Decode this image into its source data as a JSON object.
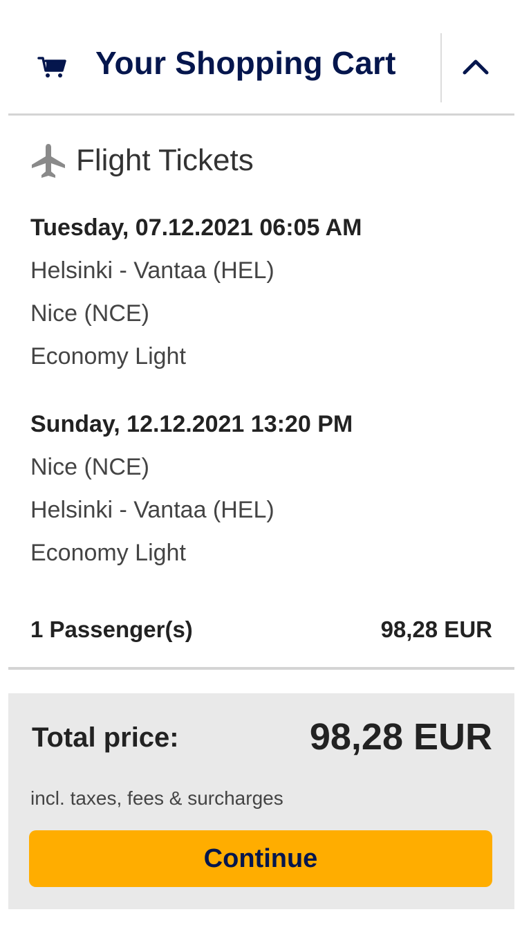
{
  "header": {
    "title": "Your Shopping Cart",
    "cart_icon": "shopping-cart-icon",
    "toggle_icon": "chevron-up-icon"
  },
  "section": {
    "title": "Flight Tickets",
    "icon": "airplane-icon"
  },
  "flights": [
    {
      "datetime": "Tuesday, 07.12.2021 06:05 AM",
      "origin": "Helsinki - Vantaa (HEL)",
      "destination": "Nice (NCE)",
      "fare": "Economy Light"
    },
    {
      "datetime": "Sunday, 12.12.2021 13:20 PM",
      "origin": "Nice (NCE)",
      "destination": "Helsinki - Vantaa (HEL)",
      "fare": "Economy Light"
    }
  ],
  "passengers": {
    "label": "1 Passenger(s)",
    "price": "98,28 EUR"
  },
  "total": {
    "label": "Total price:",
    "value": "98,28 EUR",
    "note": "incl. taxes, fees & surcharges"
  },
  "continue_label": "Continue",
  "colors": {
    "brand_navy": "#05164d",
    "button_yellow": "#ffad00",
    "total_bg": "#e9e9e9",
    "divider": "#d4d4d4"
  }
}
